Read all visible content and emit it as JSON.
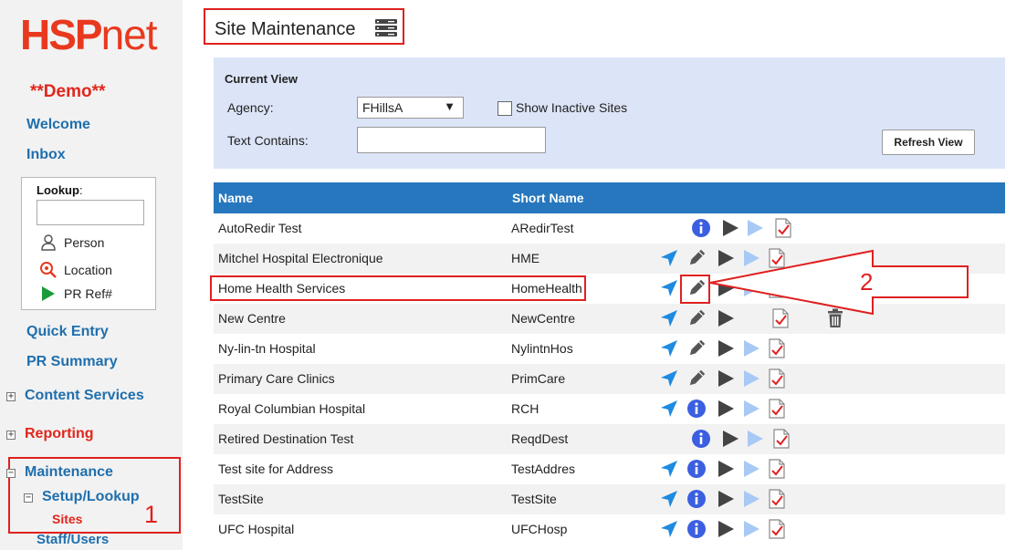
{
  "logo": {
    "part1": "HSP",
    "part2": "net"
  },
  "sidebar": {
    "demo": "**Demo**",
    "welcome": "Welcome",
    "inbox": "Inbox",
    "lookup_label": "Lookup",
    "lookup_colon": ":",
    "lookup_items": [
      "Person",
      "Location",
      "PR Ref#"
    ],
    "quick_entry": "Quick Entry",
    "pr_summary": "PR Summary",
    "content_services": "Content Services",
    "reporting": "Reporting",
    "maintenance": "Maintenance",
    "setup_lookup": "Setup/Lookup",
    "sites": "Sites",
    "staff_users": "Staff/Users",
    "annotation_number": "1"
  },
  "header": {
    "title": "Site Maintenance"
  },
  "filter": {
    "current_view": "Current View",
    "agency_label": "Agency:",
    "agency_value": "FHillsA",
    "show_inactive": "Show Inactive Sites",
    "text_contains": "Text Contains:",
    "refresh": "Refresh View"
  },
  "table": {
    "col_name": "Name",
    "col_short": "Short Name",
    "rows": [
      {
        "name": "AutoRedir Test",
        "short": "ARedirTest"
      },
      {
        "name": "Mitchel Hospital Electronique",
        "short": "HME"
      },
      {
        "name": "Home Health Services",
        "short": "HomeHealth"
      },
      {
        "name": "New Centre",
        "short": "NewCentre"
      },
      {
        "name": "Ny-lin-tn Hospital",
        "short": "NylintnHos"
      },
      {
        "name": "Primary Care Clinics",
        "short": "PrimCare"
      },
      {
        "name": "Royal Columbian Hospital",
        "short": "RCH"
      },
      {
        "name": "Retired Destination Test",
        "short": "ReqdDest"
      },
      {
        "name": "Test site for Address",
        "short": "TestAddres"
      },
      {
        "name": "TestSite",
        "short": "TestSite"
      },
      {
        "name": "UFC Hospital",
        "short": "UFCHosp"
      }
    ]
  },
  "annotation": {
    "number": "2"
  },
  "colors": {
    "accent_red": "#e02020",
    "header_blue": "#2677bd",
    "link_blue": "#1f6fad",
    "icon_blue": "#1e8ae0",
    "info_blue": "#3b5fe0"
  }
}
